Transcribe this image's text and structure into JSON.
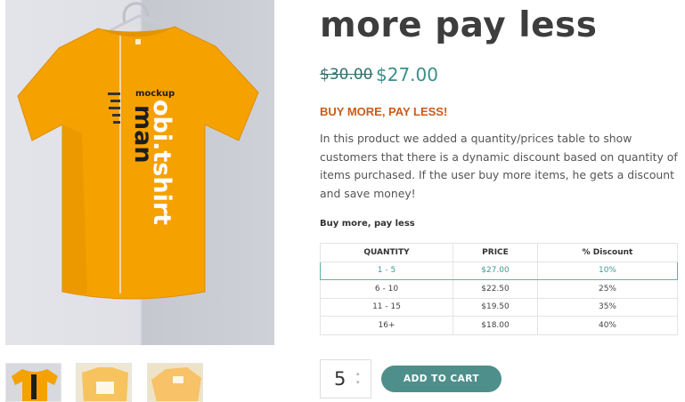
{
  "product": {
    "title": "more pay less",
    "old_price": "$30.00",
    "new_price": "$27.00",
    "promo_heading": "BUY MORE, PAY LESS!",
    "description": "In this product we added a quantity/prices table to show customers that there is a dynamic discount based on quantity of items purchased. If the user buy more items, he gets a discount and save money!",
    "image": {
      "brand_text": "obi.tshirt",
      "mockup_text": "mockup",
      "man_text": "man",
      "shirt_color": "#f5a100"
    }
  },
  "pricing_table": {
    "caption": "Buy more, pay less",
    "headers": [
      "QUANTITY",
      "PRICE",
      "% Discount"
    ],
    "rows": [
      [
        "1 - 5",
        "$27.00",
        "10%"
      ],
      [
        "6 - 10",
        "$22.50",
        "25%"
      ],
      [
        "11 - 15",
        "$19.50",
        "35%"
      ],
      [
        "16+",
        "$18.00",
        "40%"
      ]
    ],
    "active_row": 0,
    "accent_color": "#3b9b94"
  },
  "cart": {
    "quantity": "5",
    "add_to_cart_label": "ADD TO CART",
    "button_color": "#4f8f8b"
  }
}
